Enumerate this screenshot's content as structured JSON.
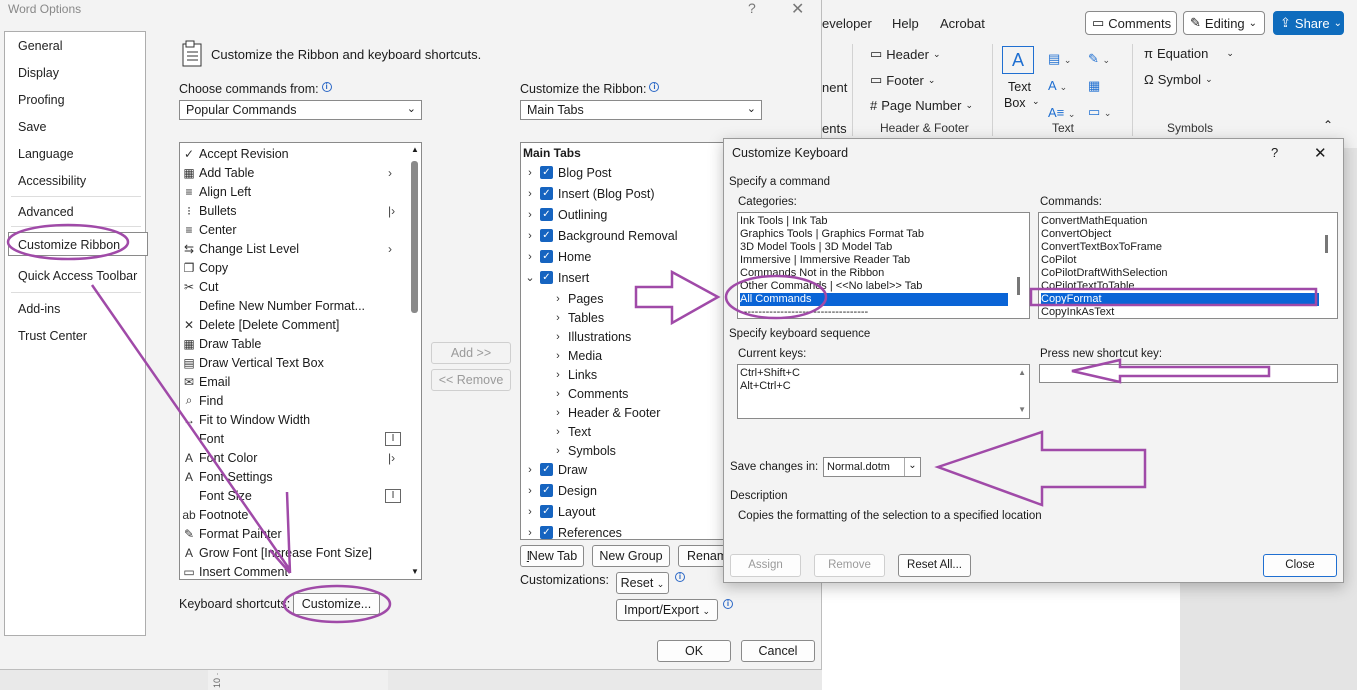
{
  "word_ribbon": {
    "tabs": [
      "eveloper",
      "Help",
      "Acrobat"
    ],
    "comments_label": "Comments",
    "editing_label": "Editing",
    "share_label": "Share",
    "partial_left": "nent",
    "partial_group": "ents",
    "header_label": "Header",
    "footer_label": "Footer",
    "page_number_label": "Page Number",
    "text_box_label_1": "Text",
    "text_box_label_2": "Box",
    "equation_label": "Equation",
    "symbol_label": "Symbol",
    "group_header_footer": "Header & Footer",
    "group_text": "Text",
    "group_symbols": "Symbols",
    "ruler_marks": "10 · ·"
  },
  "word_options": {
    "title": "Word Options",
    "help": "?",
    "close": "✕",
    "nav": [
      {
        "label": "General"
      },
      {
        "label": "Display"
      },
      {
        "label": "Proofing"
      },
      {
        "label": "Save"
      },
      {
        "label": "Language"
      },
      {
        "label": "Accessibility"
      },
      {
        "label": "Advanced"
      },
      {
        "label": "Customize Ribbon",
        "selected": true
      },
      {
        "label": "Quick Access Toolbar"
      },
      {
        "label": "Add-ins"
      },
      {
        "label": "Trust Center"
      }
    ],
    "heading": "Customize the Ribbon and keyboard shortcuts.",
    "choose_label": "Choose commands from:",
    "choose_value": "Popular Commands",
    "ribbon_label": "Customize the Ribbon:",
    "ribbon_value": "Main Tabs",
    "commands": [
      {
        "label": "Accept Revision",
        "icon": "✓"
      },
      {
        "label": "Add Table",
        "icon": "▦",
        "sub": "›"
      },
      {
        "label": "Align Left",
        "icon": "≡"
      },
      {
        "label": "Bullets",
        "icon": "⁝",
        "sub": "|›"
      },
      {
        "label": "Center",
        "icon": "≡"
      },
      {
        "label": "Change List Level",
        "icon": "⇆",
        "sub": "›"
      },
      {
        "label": "Copy",
        "icon": "❐"
      },
      {
        "label": "Cut",
        "icon": "✂"
      },
      {
        "label": "Define New Number Format...",
        "icon": ""
      },
      {
        "label": "Delete [Delete Comment]",
        "icon": "✕"
      },
      {
        "label": "Draw Table",
        "icon": "▦"
      },
      {
        "label": "Draw Vertical Text Box",
        "icon": "▤"
      },
      {
        "label": "Email",
        "icon": "✉"
      },
      {
        "label": "Find",
        "icon": "⌕"
      },
      {
        "label": "Fit to Window Width",
        "icon": "↔"
      },
      {
        "label": "Font",
        "icon": "",
        "sub2": "I"
      },
      {
        "label": "Font Color",
        "icon": "A",
        "sub": "|›"
      },
      {
        "label": "Font Settings",
        "icon": "A"
      },
      {
        "label": "Font Size",
        "icon": "",
        "sub2": "I"
      },
      {
        "label": "Footnote",
        "icon": "ab"
      },
      {
        "label": "Format Painter",
        "icon": "✎"
      },
      {
        "label": "Grow Font [Increase Font Size]",
        "icon": "A"
      },
      {
        "label": "Insert Comment",
        "icon": "▭"
      }
    ],
    "add_label": "Add >>",
    "remove_label": "<< Remove",
    "main_tabs_header": "Main Tabs",
    "tabs_tree": [
      {
        "label": "Blog Post",
        "level": 0,
        "checked": true,
        "expanded": false
      },
      {
        "label": "Insert (Blog Post)",
        "level": 0,
        "checked": true,
        "expanded": false
      },
      {
        "label": "Outlining",
        "level": 0,
        "checked": true,
        "expanded": false
      },
      {
        "label": "Background Removal",
        "level": 0,
        "checked": true,
        "expanded": false
      },
      {
        "label": "Home",
        "level": 0,
        "checked": true,
        "expanded": false
      },
      {
        "label": "Insert",
        "level": 0,
        "checked": true,
        "expanded": true
      },
      {
        "label": "Pages",
        "level": 1
      },
      {
        "label": "Tables",
        "level": 1
      },
      {
        "label": "Illustrations",
        "level": 1
      },
      {
        "label": "Media",
        "level": 1
      },
      {
        "label": "Links",
        "level": 1
      },
      {
        "label": "Comments",
        "level": 1
      },
      {
        "label": "Header & Footer",
        "level": 1
      },
      {
        "label": "Text",
        "level": 1
      },
      {
        "label": "Symbols",
        "level": 1
      },
      {
        "label": "Draw",
        "level": 0,
        "checked": true,
        "expanded": false
      },
      {
        "label": "Design",
        "level": 0,
        "checked": true,
        "expanded": false
      },
      {
        "label": "Layout",
        "level": 0,
        "checked": true,
        "expanded": false
      },
      {
        "label": "References",
        "level": 0,
        "checked": true,
        "expanded": false
      }
    ],
    "new_tab_label": "New Tab",
    "new_group_label": "New Group",
    "rename_label": "Renam",
    "customizations_label": "Customizations:",
    "reset_label": "Reset",
    "import_export_label": "Import/Export",
    "keyboard_shortcuts_label": "Keyboard shortcuts:",
    "customize_label": "Customize...",
    "ok_label": "OK",
    "cancel_label": "Cancel"
  },
  "customize_keyboard": {
    "title": "Customize Keyboard",
    "help": "?",
    "close": "✕",
    "specify_command": "Specify a command",
    "categories_label": "Categories:",
    "categories": [
      "Ink Tools | Ink Tab",
      "Graphics Tools | Graphics Format Tab",
      "3D Model Tools | 3D Model Tab",
      "Immersive | Immersive Reader Tab",
      "Commands Not in the Ribbon",
      "Other Commands | <<No label>> Tab",
      "All Commands",
      "-----------------------------------"
    ],
    "categories_selected": 6,
    "commands_label": "Commands:",
    "commands": [
      "ConvertMathEquation",
      "ConvertObject",
      "ConvertTextBoxToFrame",
      "CoPilot",
      "CoPilotDraftWithSelection",
      "CoPilotTextToTable",
      "CopyFormat",
      "CopyInkAsText"
    ],
    "commands_selected": 6,
    "specify_sequence": "Specify keyboard sequence",
    "current_keys_label": "Current keys:",
    "current_keys": [
      "Ctrl+Shift+C",
      "Alt+Ctrl+C"
    ],
    "press_new_label": "Press new shortcut key:",
    "press_new_value": "",
    "save_changes_label": "Save changes in:",
    "save_changes_value": "Normal.dotm",
    "description_label": "Description",
    "description_text": "Copies the formatting of the selection to a specified location",
    "assign_label": "Assign",
    "remove_label": "Remove",
    "reset_all_label": "Reset All...",
    "close_label": "Close"
  },
  "colors": {
    "annotation": "#a04aa8",
    "selection": "#0a64d6",
    "checkbox": "#1664c0",
    "share": "#0f6cbd"
  }
}
